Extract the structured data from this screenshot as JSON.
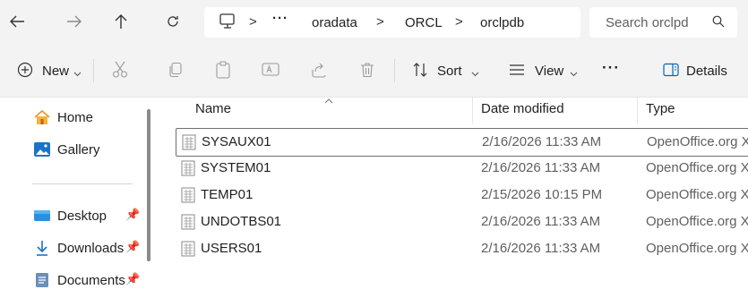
{
  "nav": {
    "back_icon": "arrow-left-icon",
    "forward_icon": "arrow-right-icon",
    "up_icon": "arrow-up-icon",
    "refresh_icon": "refresh-icon"
  },
  "address": {
    "more": "···",
    "sep": ">",
    "crumbs": [
      "oradata",
      "ORCL",
      "orclpdb"
    ]
  },
  "search": {
    "placeholder": "Search orclpd"
  },
  "toolbar": {
    "new_label": "New",
    "sort_label": "Sort",
    "view_label": "View",
    "more_label": "···",
    "details_label": "Details"
  },
  "sidebar": {
    "items": [
      {
        "label": "Home",
        "icon": "home-icon",
        "pinned": false
      },
      {
        "label": "Gallery",
        "icon": "gallery-icon",
        "pinned": false
      },
      {
        "label": "Desktop",
        "icon": "desktop-icon",
        "pinned": true
      },
      {
        "label": "Downloads",
        "icon": "download-icon",
        "pinned": true
      },
      {
        "label": "Documents",
        "icon": "documents-icon",
        "pinned": true
      }
    ]
  },
  "list": {
    "columns": [
      "Name",
      "Date modified",
      "Type"
    ],
    "rows": [
      {
        "name": "SYSAUX01",
        "date": "2/16/2026 11:33 AM",
        "type": "OpenOffice.org XML",
        "selected": true
      },
      {
        "name": "SYSTEM01",
        "date": "2/16/2026 11:33 AM",
        "type": "OpenOffice.org XML",
        "selected": false
      },
      {
        "name": "TEMP01",
        "date": "2/15/2026 10:15 PM",
        "type": "OpenOffice.org XML",
        "selected": false
      },
      {
        "name": "UNDOTBS01",
        "date": "2/16/2026 11:33 AM",
        "type": "OpenOffice.org XML",
        "selected": false
      },
      {
        "name": "USERS01",
        "date": "2/16/2026 11:33 AM",
        "type": "OpenOffice.org XML",
        "selected": false
      }
    ]
  },
  "colors": {
    "accent": "#0067c0",
    "chrome": "#f3f3f3"
  }
}
